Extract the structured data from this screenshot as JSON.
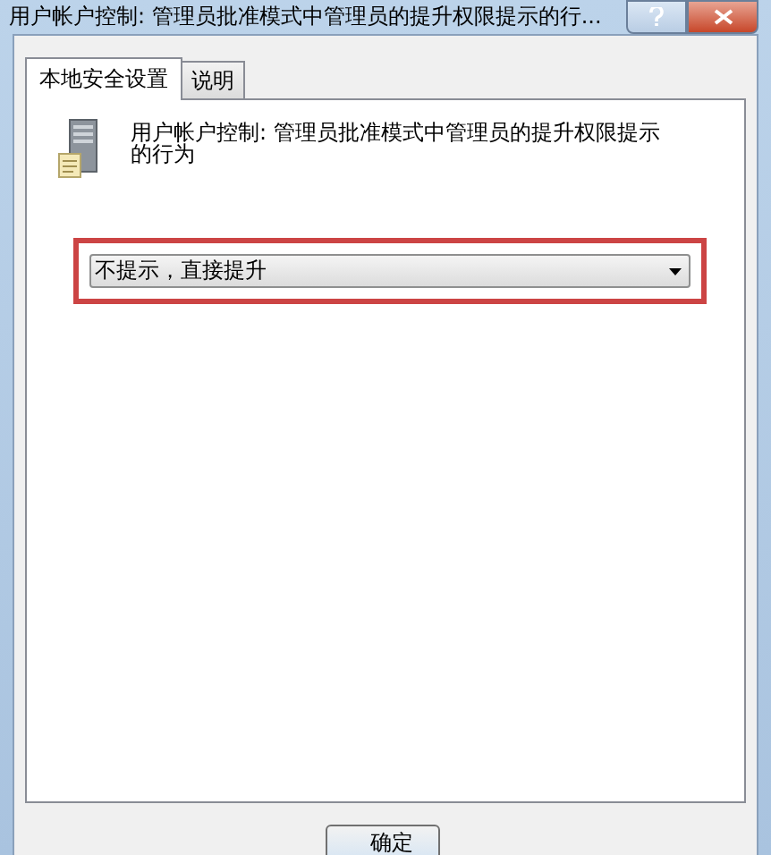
{
  "window": {
    "title": "用户帐户控制: 管理员批准模式中管理员的提升权限提示的行..."
  },
  "tabs": [
    {
      "label": "本地安全设置",
      "selected": true
    },
    {
      "label": "说明",
      "selected": false
    }
  ],
  "policy": {
    "description": "用户帐户控制: 管理员批准模式中管理员的提升权限提示的行为"
  },
  "setting": {
    "value": "不提示，直接提升",
    "highlighted": true
  },
  "buttons": [
    "确定"
  ]
}
